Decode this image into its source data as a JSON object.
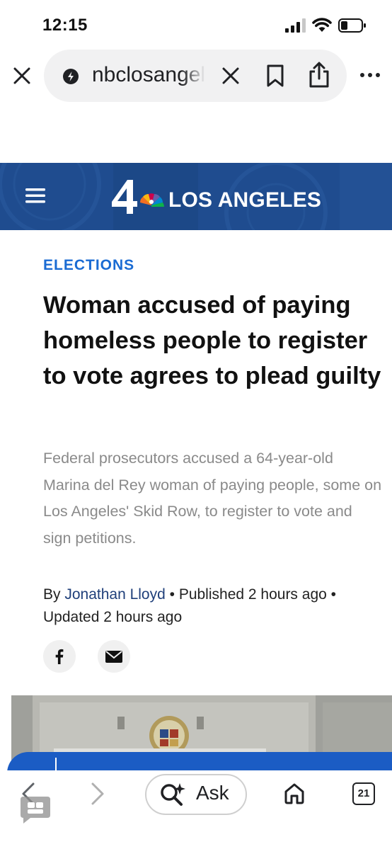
{
  "status_bar": {
    "time": "12:15"
  },
  "browser": {
    "url": "nbclosangeles.com",
    "ask_label": "Ask",
    "tab_count": "21"
  },
  "site": {
    "logo_text": "LOS ANGELES",
    "brand_color": "#1f4c8f"
  },
  "article": {
    "category": "ELECTIONS",
    "headline": "Woman accused of paying homeless people to register to vote agrees to plead guilty",
    "dek": "Federal prosecutors accused a 64-year-old Marina del Rey woman of paying people, some on Los Angeles' Skid Row, to register to vote and sign petitions.",
    "byline_prefix": "By ",
    "author": "Jonathan Lloyd",
    "published": " • Published 2 hours ago • Updated 2 hours ago"
  },
  "colors": {
    "accent": "#1a6bd3",
    "bottom_bar": "#1b5cc4"
  },
  "icons": [
    "signal-icon",
    "wifi-icon",
    "battery-icon",
    "close-icon",
    "lock-icon",
    "clear-icon",
    "bookmark-icon",
    "share-icon",
    "more-icon",
    "hamburger-icon",
    "facebook-icon",
    "email-icon",
    "back-icon",
    "forward-icon",
    "ask-search-icon",
    "home-icon",
    "tabs-icon",
    "chat-icon"
  ]
}
